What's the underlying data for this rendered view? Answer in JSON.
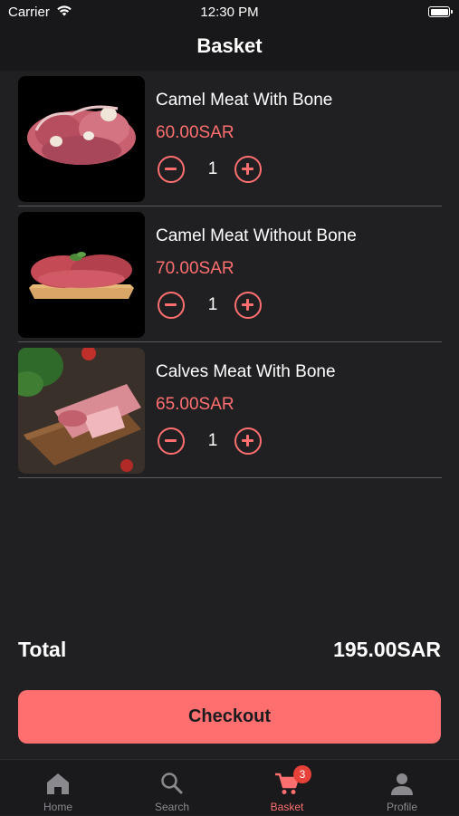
{
  "status_bar": {
    "carrier": "Carrier",
    "time": "12:30 PM"
  },
  "header": {
    "title": "Basket"
  },
  "items": [
    {
      "name": "Camel Meat With Bone",
      "price": "60.00SAR",
      "quantity": "1",
      "image": "camel-meat-with-bone-photo"
    },
    {
      "name": "Camel Meat Without Bone",
      "price": "70.00SAR",
      "quantity": "1",
      "image": "camel-meat-without-bone-photo"
    },
    {
      "name": "Calves Meat With Bone",
      "price": "65.00SAR",
      "quantity": "1",
      "image": "calves-meat-with-bone-photo"
    }
  ],
  "summary": {
    "total_label": "Total",
    "total_value": "195.00SAR"
  },
  "checkout": {
    "label": "Checkout"
  },
  "tab_bar": {
    "tabs": [
      {
        "label": "Home",
        "icon": "home-icon"
      },
      {
        "label": "Search",
        "icon": "search-icon"
      },
      {
        "label": "Basket",
        "icon": "cart-icon",
        "badge": "3",
        "active": true
      },
      {
        "label": "Profile",
        "icon": "person-icon"
      }
    ]
  },
  "colors": {
    "accent": "#ff6f6f",
    "background": "#202023",
    "badge": "#e8413a",
    "text": "#ffffff"
  }
}
